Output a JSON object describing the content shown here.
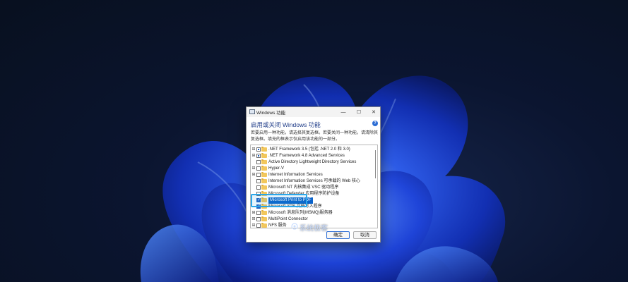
{
  "dialog": {
    "title": "Windows 功能",
    "heading": "启用或关闭 Windows 功能",
    "description": "若要启用一种功能，请选择其复选框。若要关闭一种功能，请清除其复选框。填充的框表示仅启用该功能的一部分。",
    "minimize": "—",
    "maximize": "☐",
    "close": "✕",
    "help": "?",
    "ok_label": "确定",
    "cancel_label": "取消"
  },
  "features": [
    {
      "label": ".NET Framework 3.5 (包括 .NET 2.0 和 3.0)",
      "expandable": true,
      "state": "partial"
    },
    {
      "label": ".NET Framework 4.8 Advanced Services",
      "expandable": true,
      "state": "partial"
    },
    {
      "label": "Active Directory Lightweight Directory Services",
      "expandable": false,
      "state": "unchecked"
    },
    {
      "label": "Hyper-V",
      "expandable": true,
      "state": "unchecked"
    },
    {
      "label": "Internet Information Services",
      "expandable": true,
      "state": "unchecked"
    },
    {
      "label": "Internet Information Services 可承载的 Web 核心",
      "expandable": false,
      "state": "unchecked"
    },
    {
      "label": "Microsoft NT 内核集成 VSC 驱动程序",
      "expandable": false,
      "state": "unchecked"
    },
    {
      "label": "Microsoft Defender 应用程序防护设备",
      "expandable": false,
      "state": "unchecked"
    },
    {
      "label": "Microsoft Print to PDF",
      "expandable": false,
      "state": "checked",
      "selected": true
    },
    {
      "label": "Microsoft XPS 文档写入程序",
      "expandable": false,
      "state": "checked"
    },
    {
      "label": "Microsoft 消息队列(MSMQ)服务器",
      "expandable": true,
      "state": "unchecked"
    },
    {
      "label": "MultiPoint Connector",
      "expandable": true,
      "state": "unchecked"
    },
    {
      "label": "NFS 服务",
      "expandable": true,
      "state": "unchecked"
    }
  ],
  "watermark": {
    "text": "系统极客"
  },
  "colors": {
    "accent": "#0a62c9",
    "highlight": "#2aa7ea",
    "folder": "#f2c75c"
  }
}
